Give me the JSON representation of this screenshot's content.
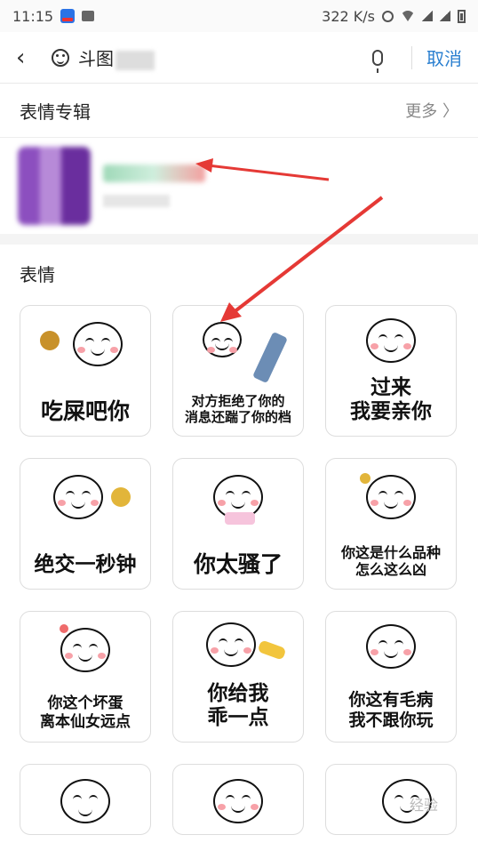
{
  "status_bar": {
    "time": "11:15",
    "network_speed": "322 K/s"
  },
  "search": {
    "query": "斗图",
    "cancel_label": "取消"
  },
  "albums": {
    "title": "表情专辑",
    "more_label": "更多 〉"
  },
  "stickers": {
    "title": "表情",
    "items": [
      {
        "caption": "吃屎吧你"
      },
      {
        "caption": "对方拒绝了你的\n消息还踹了你的档"
      },
      {
        "caption": "过来\n我要亲你"
      },
      {
        "caption": "绝交一秒钟"
      },
      {
        "caption": "你太骚了"
      },
      {
        "caption": "你这是什么品种\n怎么这么凶"
      },
      {
        "caption": "你这个坏蛋\n离本仙女远点"
      },
      {
        "caption": "你给我\n乖一点"
      },
      {
        "caption": "你这有毛病\n我不跟你玩"
      }
    ]
  },
  "watermark": "经验",
  "colors": {
    "accent": "#2a7fd0",
    "arrow": "#e53935",
    "cheek": "#f7a1a8"
  }
}
